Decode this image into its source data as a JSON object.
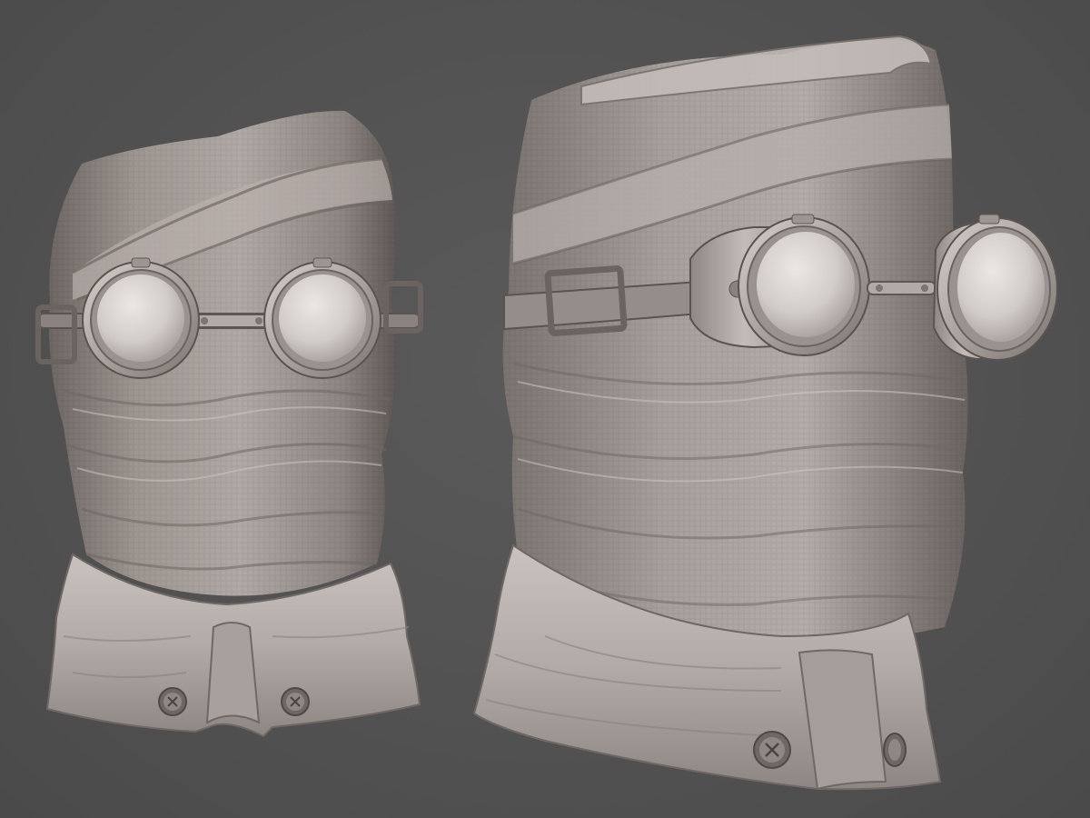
{
  "scene": {
    "background_color": "#545454",
    "material_color": "#a39b97",
    "material_shadow": "#5e5754",
    "material_highlight": "#d8d1cd",
    "lens_color": "#d9d4d2",
    "views": [
      {
        "name": "bust-front-view"
      },
      {
        "name": "bust-three-quarter-view"
      }
    ]
  }
}
